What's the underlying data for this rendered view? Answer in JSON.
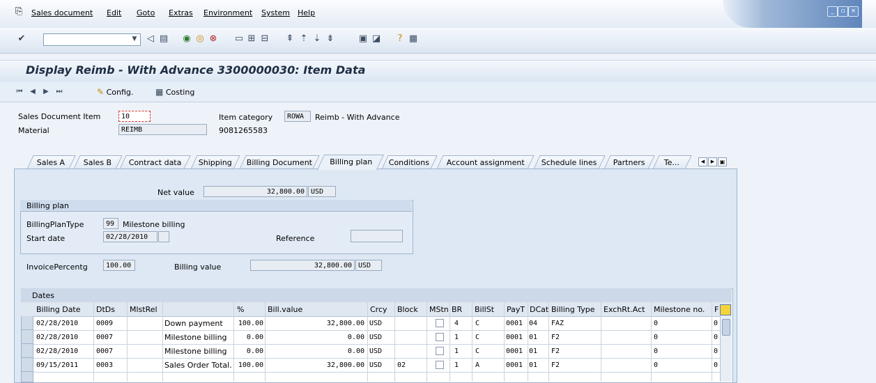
{
  "menu": {
    "items": [
      "Sales document",
      "Edit",
      "Goto",
      "Extras",
      "Environment",
      "System",
      "Help"
    ]
  },
  "window": {
    "title": "Display Reimb - With Advance 3300000030: Item Data"
  },
  "appbar": {
    "config_label": "Config.",
    "costing_label": "Costing"
  },
  "header": {
    "item_label": "Sales Document Item",
    "item_value": "10",
    "material_label": "Material",
    "material_value": "REIMB",
    "material_number": "9081265583",
    "item_category_label": "Item category",
    "item_category_code": "ROWA",
    "item_category_text": "Reimb - With Advance"
  },
  "tabs": [
    "Sales A",
    "Sales B",
    "Contract data",
    "Shipping",
    "Billing Document",
    "Billing plan",
    "Conditions",
    "Account assignment",
    "Schedule lines",
    "Partners",
    "Te..."
  ],
  "active_tab": "Billing plan",
  "billing": {
    "net_value_label": "Net value",
    "net_value": "32,800.00",
    "currency": "USD",
    "group_title": "Billing plan",
    "plan_type_label": "BillingPlanType",
    "plan_type_code": "99",
    "plan_type_text": "Milestone billing",
    "start_date_label": "Start date",
    "start_date": "02/28/2010",
    "reference_label": "Reference",
    "invoice_pct_label": "InvoicePercentg",
    "invoice_pct": "100.00",
    "billing_value_label": "Billing value",
    "billing_value": "32,800.00",
    "billing_currency": "USD"
  },
  "dates_table": {
    "title": "Dates",
    "columns": [
      "Billing Date",
      "DtDs",
      "MlstRel",
      "",
      "%",
      "Bill.value",
      "Crcy",
      "Block",
      "MStn",
      "BR",
      "BillSt",
      "PayT",
      "DCat",
      "Billing Type",
      "ExchRt.Act",
      "Milestone no.",
      "F"
    ],
    "rows": [
      [
        "02/28/2010",
        "0009",
        "",
        "Down payment",
        "100.00",
        "32,800.00",
        "USD",
        "",
        "",
        "4",
        "C",
        "0001",
        "04",
        "FAZ",
        "",
        "0",
        "0"
      ],
      [
        "02/28/2010",
        "0007",
        "",
        "Milestone billing",
        "0.00",
        "0.00",
        "USD",
        "",
        "",
        "1",
        "C",
        "0001",
        "01",
        "F2",
        "",
        "0",
        "0"
      ],
      [
        "02/28/2010",
        "0007",
        "",
        "Milestone billing",
        "0.00",
        "0.00",
        "USD",
        "",
        "",
        "1",
        "C",
        "0001",
        "01",
        "F2",
        "",
        "0",
        "0"
      ],
      [
        "09/15/2011",
        "0003",
        "",
        "Sales Order Total...",
        "100.00",
        "32,800.00",
        "USD",
        "02",
        "",
        "1",
        "A",
        "0001",
        "01",
        "F2",
        "",
        "0",
        "0"
      ]
    ]
  },
  "colors": {
    "accent": "#1f2f44",
    "panel": "#dde8f4",
    "highlight_box": "#d9342b"
  }
}
